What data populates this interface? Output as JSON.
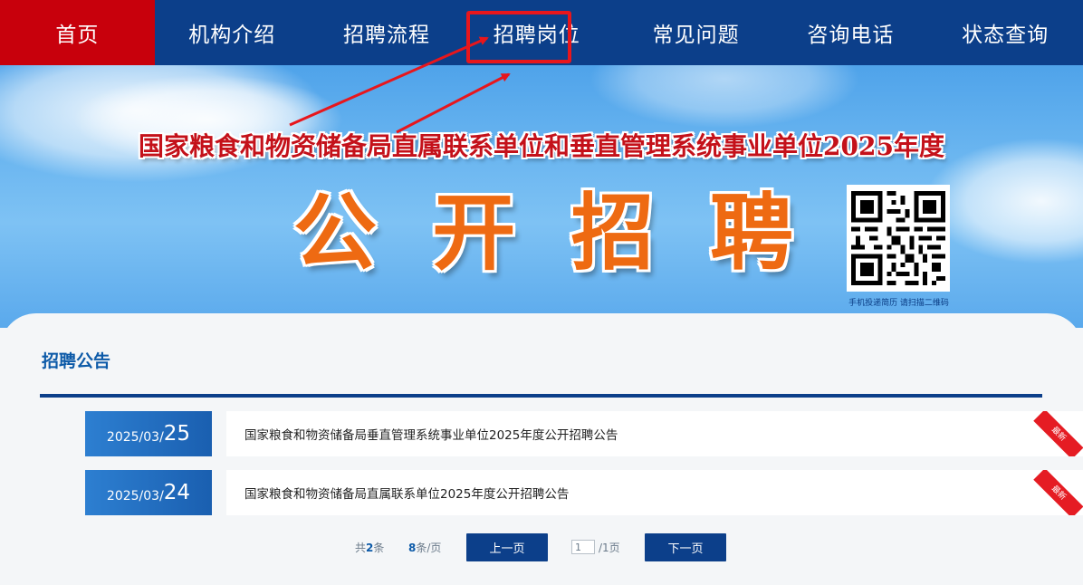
{
  "nav": {
    "items": [
      {
        "label": "首页"
      },
      {
        "label": "机构介绍"
      },
      {
        "label": "招聘流程"
      },
      {
        "label": "招聘岗位"
      },
      {
        "label": "常见问题"
      },
      {
        "label": "咨询电话"
      },
      {
        "label": "状态查询"
      }
    ]
  },
  "banner": {
    "subtitle": "国家粮食和物资储备局直属联系单位和垂直管理系统事业单位2025年度",
    "title_chars": [
      "公",
      "开",
      "招",
      "聘"
    ],
    "qr_caption": "手机投递简历 请扫描二维码"
  },
  "section": {
    "title": "招聘公告"
  },
  "announcements": [
    {
      "ym": "2025/03/",
      "day": "25",
      "title": "国家粮食和物资储备局垂直管理系统事业单位2025年度公开招聘公告",
      "badge": "最新"
    },
    {
      "ym": "2025/03/",
      "day": "24",
      "title": "国家粮食和物资储备局直属联系单位2025年度公开招聘公告",
      "badge": "最新"
    }
  ],
  "pager": {
    "total_prefix": "共",
    "total_count": "2",
    "total_suffix": "条",
    "per_page_count": "8",
    "per_page_suffix": "条/页",
    "prev_label": "上一页",
    "page_value": "1",
    "page_of": "/1页",
    "next_label": "下一页"
  },
  "colors": {
    "nav_bg": "#0c3f8a",
    "nav_active": "#c8000c",
    "highlight_box": "#e8161c",
    "accent": "#0c5aa8"
  }
}
